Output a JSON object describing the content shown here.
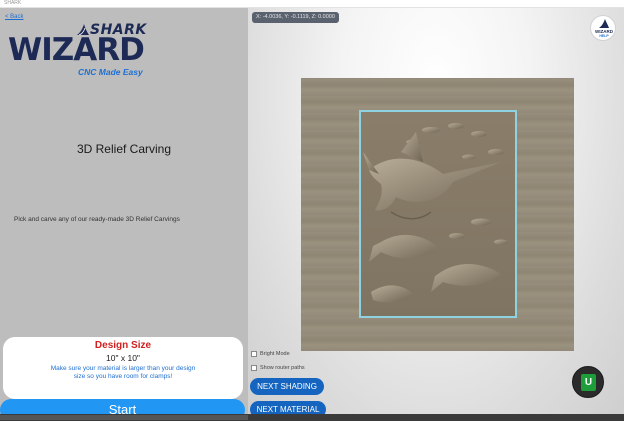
{
  "titlebar": {
    "text": "SHARK"
  },
  "left_panel": {
    "back_label": "< Back",
    "logo": {
      "brand_top": "SHARK",
      "brand_main": "WIZARD",
      "tagline": "CNC Made Easy"
    },
    "section_title": "3D Relief Carving",
    "description": "Pick and carve any of our ready-made 3D Relief Carvings",
    "design_card": {
      "title": "Design Size",
      "size": "10\" x 10\"",
      "note": "Make sure your material is larger than your design size so you have room for clamps!"
    },
    "start_label": "Start"
  },
  "viewer": {
    "coords": "X: -4.0036, Y: -0.1119, Z: 0.0000",
    "help": {
      "line1": "WIZARD",
      "line2": "HELP"
    },
    "checkboxes": {
      "bright_mode": "Bright Mode",
      "show_router_paths": "Show router paths"
    },
    "buttons": {
      "next_shading": "NEXT SHADING",
      "next_material": "NEXT MATERIAL",
      "u_label": "U"
    }
  },
  "colors": {
    "accent": "#2196f3",
    "brand_navy": "#1d2a55",
    "design_title": "#d21f1f",
    "pill": "#1565c0",
    "u_green": "#1e9e3a"
  },
  "icons": [
    "shark-fin-icon",
    "wizard-help-icon",
    "checkbox-icon",
    "u-icon"
  ]
}
